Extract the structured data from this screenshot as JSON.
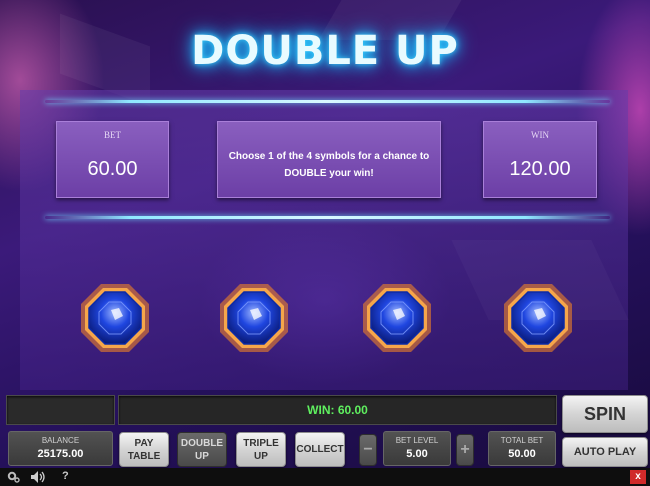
{
  "game": {
    "title": "DOUBLE UP",
    "bet": {
      "label": "BET",
      "value": "60.00"
    },
    "message": "Choose 1 of the 4 symbols for a chance to DOUBLE your win!",
    "win": {
      "label": "WIN",
      "value": "120.00"
    },
    "symbols": [
      {
        "name": "blue-gem"
      },
      {
        "name": "blue-gem"
      },
      {
        "name": "blue-gem"
      },
      {
        "name": "blue-gem"
      }
    ]
  },
  "controls": {
    "win_display": "WIN: 60.00",
    "balance": {
      "label": "BALANCE",
      "value": "25175.00"
    },
    "pay_table": "PAY TABLE",
    "double_up": "DOUBLE UP",
    "triple_up": "TRIPLE UP",
    "collect": "COLLECT",
    "minus": "−",
    "plus": "+",
    "bet_level": {
      "label": "BET LEVEL",
      "value": "5.00"
    },
    "total_bet": {
      "label": "TOTAL BET",
      "value": "50.00"
    },
    "spin": "SPIN",
    "auto_play": "AUTO PLAY"
  },
  "footer": {
    "settings_icon": "gear-icon",
    "sound_icon": "speaker-icon",
    "help": "?",
    "close": "x"
  },
  "colors": {
    "title_glow": "#19b8ff",
    "win_text": "#5ff05f",
    "gem_blue": "#1f46e0",
    "gem_glow": "#ff8a1e",
    "close_red": "#d02a2a"
  }
}
